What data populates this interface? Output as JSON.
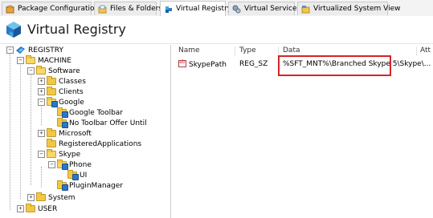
{
  "tabs": [
    {
      "label": "Package Configuration",
      "icon": "package-config-icon"
    },
    {
      "label": "Files & Folders",
      "icon": "files-folders-icon"
    },
    {
      "label": "Virtual Registry",
      "icon": "virtual-registry-icon",
      "active": true
    },
    {
      "label": "Virtual Services",
      "icon": "virtual-services-icon"
    },
    {
      "label": "Virtualized System View",
      "icon": "system-view-icon"
    }
  ],
  "header": {
    "title": "Virtual Registry",
    "icon": "registry-cube-icon"
  },
  "tree": {
    "nodes": [
      {
        "label": "REGISTRY",
        "level": 0,
        "toggle": "-",
        "icon": "registry-icon"
      },
      {
        "label": "MACHINE",
        "level": 1,
        "toggle": "-",
        "icon": "folder-open"
      },
      {
        "label": "Software",
        "level": 2,
        "toggle": "-",
        "icon": "folder-open"
      },
      {
        "label": "Classes",
        "level": 3,
        "toggle": "+",
        "icon": "folder"
      },
      {
        "label": "Clients",
        "level": 3,
        "toggle": "+",
        "icon": "folder"
      },
      {
        "label": "Google",
        "level": 3,
        "toggle": "-",
        "icon": "folder-virtual-open"
      },
      {
        "label": "Google Toolbar",
        "level": 4,
        "toggle": "",
        "icon": "folder-virtual"
      },
      {
        "label": "No Toolbar Offer Until",
        "level": 4,
        "toggle": "",
        "icon": "folder-virtual"
      },
      {
        "label": "Microsoft",
        "level": 3,
        "toggle": "+",
        "icon": "folder"
      },
      {
        "label": "RegisteredApplications",
        "level": 3,
        "toggle": "",
        "icon": "folder"
      },
      {
        "label": "Skype",
        "level": 3,
        "toggle": "-",
        "icon": "folder-open"
      },
      {
        "label": "Phone",
        "level": 4,
        "toggle": "-",
        "icon": "folder-virtual-open"
      },
      {
        "label": "UI",
        "level": 5,
        "toggle": "",
        "icon": "folder-virtual"
      },
      {
        "label": "PluginManager",
        "level": 4,
        "toggle": "",
        "icon": "folder-virtual"
      },
      {
        "label": "System",
        "level": 2,
        "toggle": "+",
        "icon": "folder"
      },
      {
        "label": "USER",
        "level": 1,
        "toggle": "+",
        "icon": "folder"
      }
    ]
  },
  "list": {
    "columns": [
      "Name",
      "Type",
      "Data",
      "Att"
    ],
    "rows": [
      {
        "name": "SkypePath",
        "type": "REG_SZ",
        "data": "%SFT_MNT%\\Branched Skype 5\\Skype\\..."
      }
    ]
  },
  "colors": {
    "highlight": "#d3242a",
    "folder": "#f0c846",
    "badge": "#2a78c8"
  }
}
